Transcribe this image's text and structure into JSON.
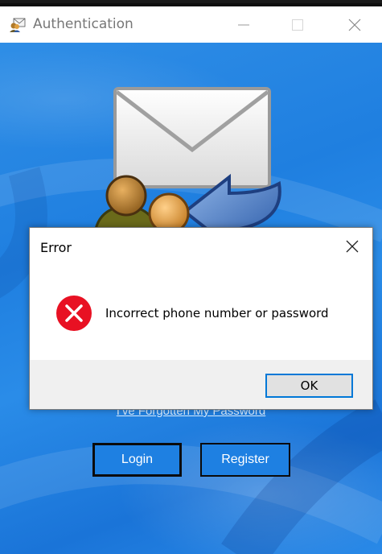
{
  "window": {
    "title": "Authentication",
    "icon": "envelope-users-icon"
  },
  "main": {
    "forgot_link": "I've Forgotten My Password",
    "login_label": "Login",
    "register_label": "Register",
    "hero_icon": "mail-contacts-icon"
  },
  "dialog": {
    "title": "Error",
    "message": "Incorrect phone number or password",
    "ok_label": "OK",
    "icon": "error-icon"
  },
  "colors": {
    "background_blue": "#1f7fe0",
    "button_fill": "#1e80e2",
    "ok_focus_border": "#0078d7",
    "error_red": "#e81123"
  }
}
